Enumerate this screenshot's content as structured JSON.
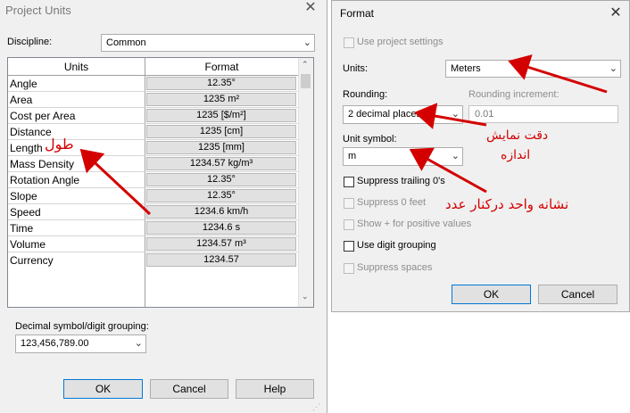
{
  "project_units": {
    "title": "Project Units",
    "discipline_label": "Discipline:",
    "discipline_value": "Common",
    "columns": [
      "Units",
      "Format"
    ],
    "rows": [
      {
        "unit": "Angle",
        "format": "12.35°"
      },
      {
        "unit": "Area",
        "format": "1235 m²"
      },
      {
        "unit": "Cost per Area",
        "format": "1235 [$/m²]"
      },
      {
        "unit": "Distance",
        "format": "1235 [cm]"
      },
      {
        "unit": "Length",
        "format": "1235 [mm]"
      },
      {
        "unit": "Mass Density",
        "format": "1234.57 kg/m³"
      },
      {
        "unit": "Rotation Angle",
        "format": "12.35°"
      },
      {
        "unit": "Slope",
        "format": "12.35°"
      },
      {
        "unit": "Speed",
        "format": "1234.6 km/h"
      },
      {
        "unit": "Time",
        "format": "1234.6 s"
      },
      {
        "unit": "Volume",
        "format": "1234.57 m³"
      },
      {
        "unit": "Currency",
        "format": "1234.57"
      }
    ],
    "decimal_label": "Decimal symbol/digit grouping:",
    "decimal_value": "123,456,789.00",
    "ok": "OK",
    "cancel": "Cancel",
    "help": "Help"
  },
  "format": {
    "title": "Format",
    "use_project_settings": "Use project settings",
    "units_label": "Units:",
    "units_value": "Meters",
    "rounding_label": "Rounding:",
    "rounding_value": "2 decimal places",
    "rounding_increment_label": "Rounding increment:",
    "rounding_increment_value": "0.01",
    "unit_symbol_label": "Unit symbol:",
    "unit_symbol_value": "m",
    "suppress_trailing": "Suppress trailing 0's",
    "suppress_feet": "Suppress 0 feet",
    "show_plus": "Show + for positive values",
    "digit_grouping": "Use digit grouping",
    "suppress_spaces": "Suppress spaces",
    "ok": "OK",
    "cancel": "Cancel"
  },
  "annotations": {
    "length": "طول",
    "precision_line1": "دقت نمایش",
    "precision_line2": "اندازه",
    "unit_symbol": "نشانه واحد درکنار عدد",
    "color": "#d40000"
  }
}
